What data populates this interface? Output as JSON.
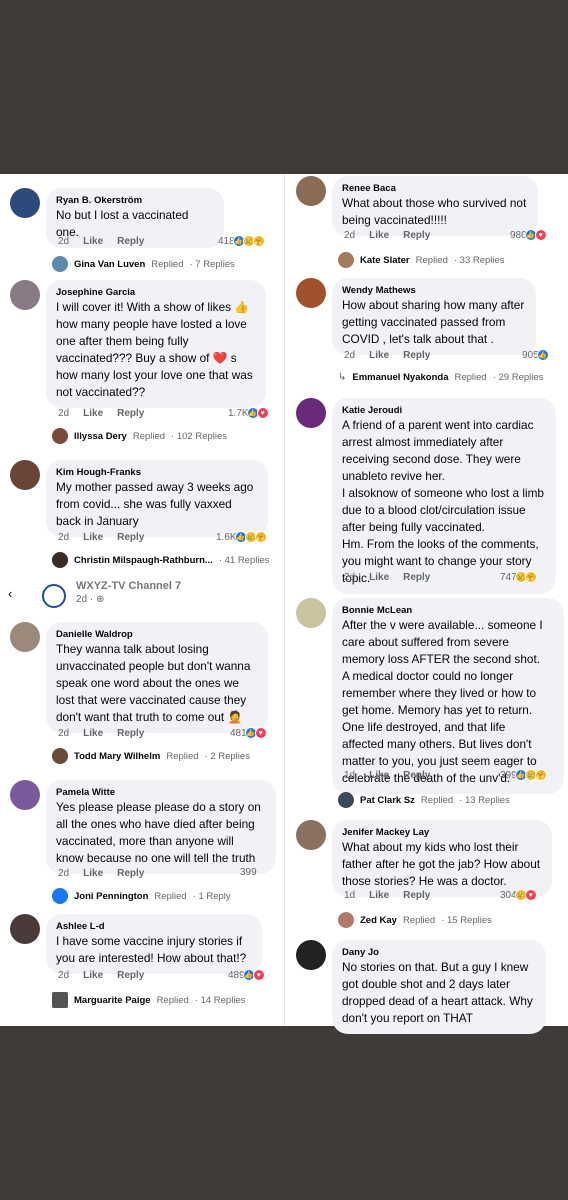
{
  "left": [
    {
      "author": "Ryan B. Okerström",
      "text": "No but I lost a vaccinated one.",
      "time": "2d",
      "like": "Like",
      "reply": "Reply",
      "count": "418",
      "replier": "Gina Van Luven",
      "replied": "Replied",
      "replies": "· 7 Replies",
      "avatar_color": "#2c4b7a"
    },
    {
      "author": "Josephine Garcia",
      "text": "I will cover it! With a show of likes 👍\nhow many people  have losted a love\none after them being fully\nvaccinated??? Buy a show  of  ❤️ s\nhow many lost your love one that was\nnot vaccinated??",
      "time": "2d",
      "like": "Like",
      "reply": "Reply",
      "count": "1.7K",
      "replier": "Illyssa Dery",
      "replied": "Replied",
      "replies": "· 102 Replies",
      "avatar_color": "#8a7a86"
    },
    {
      "author": "Kim Hough-Franks",
      "text": "My mother passed away 3 weeks ago\nfrom covid... she was fully vaxxed\nback in January",
      "time": "2d",
      "like": "Like",
      "reply": "Reply",
      "count": "1.6K",
      "replier": "Christin Milspaugh-Rathburn...",
      "replied": "",
      "replies": "· 41 Replies",
      "avatar_color": "#6b4438"
    },
    {
      "author": "Danielle Waldrop",
      "text": "They wanna talk about losing\nunvaccinated people but don't wanna\nspeak one word about the ones we\nlost that were vaccinated cause they\ndon't want that truth to come out 🤦",
      "time": "2d",
      "like": "Like",
      "reply": "Reply",
      "count": "481",
      "replier": "Todd Mary Wilhelm",
      "replied": "Replied",
      "replies": "· 2 Replies",
      "avatar_color": "#9b8a7a"
    },
    {
      "author": "Pamela Witte",
      "text": "Yes please please please do a story on\nall the ones who have died after being\nvaccinated, more than anyone will\nknow because no one will tell the truth",
      "time": "2d",
      "like": "Like",
      "reply": "Reply",
      "count": "399",
      "replier": "Joni Pennington",
      "replied": "Replied",
      "replies": "· 1 Reply",
      "avatar_color": "#7a5a9a"
    },
    {
      "author": "Ashlee L-d",
      "text": "I have some vaccine injury stories if\nyou are interested! How about that!?",
      "time": "2d",
      "like": "Like",
      "reply": "Reply",
      "count": "489",
      "replier": "Marguarite Paige",
      "replied": "Replied",
      "replies": "· 14 Replies",
      "avatar_color": "#4a3a3a"
    }
  ],
  "right": [
    {
      "author": "Renee Baca",
      "text": "What about those who survived not\nbeing vaccinated!!!!!",
      "time": "2d",
      "like": "Like",
      "reply": "Reply",
      "count": "980",
      "replier": "Kate Slater",
      "replied": "Replied",
      "replies": "· 33 Replies",
      "avatar_color": "#8a6b55"
    },
    {
      "author": "Wendy Mathews",
      "text": "How about sharing how many after\ngetting vaccinated passed from\nCOVID , let's talk about that .",
      "time": "2d",
      "like": "Like",
      "reply": "Reply",
      "count": "905",
      "replier": "Emmanuel Nyakonda",
      "replied": "Replied",
      "replies": "· 29 Replies",
      "avatar_color": "#a0522d"
    },
    {
      "author": "Katie Jeroudi",
      "text": "A friend of a parent went into cardiac\narrest almost immediately after\nreceiving second dose. They were\nunableto revive her.\nI alsoknow of someone who lost a limb\ndue to a blood clot/circulation issue\nafter being fully vaccinated.\nHm. From the looks of the comments,\nyou might want to change your story\ntopic.",
      "time": "2d",
      "like": "Like",
      "reply": "Reply",
      "count": "747",
      "replier": "",
      "replied": "",
      "replies": "",
      "avatar_color": "#6a2a7a"
    },
    {
      "author": "Bonnie McLean",
      "text": "After the v were available...  someone I\ncare about suffered from severe\nmemory loss AFTER the second shot.\nA medical doctor could no longer\nremember where they lived or how to\nget home.  Memory has yet to return.\nOne life destroyed, and that life\naffected many others.  But lives don't\nmatter to you, you just seem eager to\ncelebrate the death of the unv'd.",
      "time": "1d",
      "like": "Like",
      "reply": "Reply",
      "count": "399",
      "replier": "Pat Clark Sz",
      "replied": "Replied",
      "replies": "· 13 Replies",
      "avatar_color": "#c9c3a0"
    },
    {
      "author": "Jenifer Mackey Lay",
      "text": "What about my kids who lost their\nfather after he got the jab? How about\nthose stories? He was a doctor.",
      "time": "1d",
      "like": "Like",
      "reply": "Reply",
      "count": "304",
      "replier": "Zed Kay",
      "replied": "Replied",
      "replies": "· 15 Replies",
      "avatar_color": "#8a7060"
    },
    {
      "author": "Dany Jo",
      "text": "No stories on that. But a guy I knew\ngot double shot and 2 days later\ndropped dead of a heart attack. Why\ndon't you report on THAT",
      "time": "",
      "like": "",
      "reply": "",
      "count": "",
      "replier": "",
      "replied": "",
      "replies": "",
      "avatar_color": "#222222"
    }
  ],
  "page_header": {
    "back": "‹",
    "name": "WXYZ-TV Channel 7",
    "time": "2d · ⊕"
  }
}
